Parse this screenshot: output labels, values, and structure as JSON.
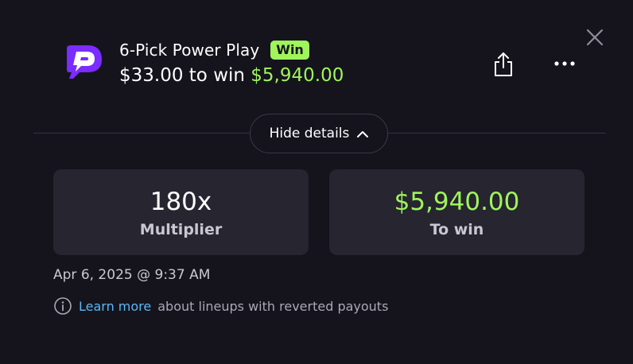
{
  "header": {
    "title": "6-Pick Power Play",
    "badge": "Win",
    "stake_text": "$33.00 to win",
    "win_amount": "$5,940.00"
  },
  "icons": {
    "close": "close-icon",
    "share": "share-icon",
    "more": "more-icon",
    "logo": "prizepicks-logo",
    "info": "info-icon",
    "chevron": "chevron-up-icon"
  },
  "details_toggle": {
    "label": "Hide details"
  },
  "stats": {
    "multiplier": {
      "value": "180x",
      "label": "Multiplier"
    },
    "to_win": {
      "value": "$5,940.00",
      "label": "To win"
    }
  },
  "timestamp": "Apr 6, 2025 @ 9:37 AM",
  "info": {
    "link_text": "Learn more",
    "text": "about lineups with reverted payouts"
  },
  "colors": {
    "background": "#15141d",
    "card": "#262530",
    "accent_green": "#9ff55a",
    "link_blue": "#5ab8f5",
    "logo_purple": "#7b2cff"
  }
}
